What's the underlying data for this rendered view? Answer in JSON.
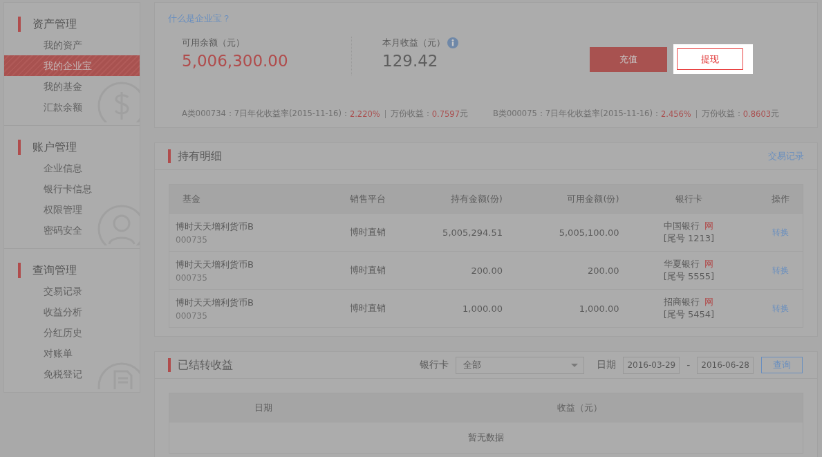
{
  "sidebar": {
    "groups": [
      {
        "title": "资产管理",
        "kind": "assets",
        "items": [
          {
            "label": "我的资产",
            "selected": false
          },
          {
            "label": "我的企业宝",
            "selected": true
          },
          {
            "label": "我的基金",
            "selected": false
          },
          {
            "label": "汇款余额",
            "selected": false
          }
        ]
      },
      {
        "title": "账户管理",
        "kind": "account",
        "items": [
          {
            "label": "企业信息",
            "selected": false
          },
          {
            "label": "银行卡信息",
            "selected": false
          },
          {
            "label": "权限管理",
            "selected": false
          },
          {
            "label": "密码安全",
            "selected": false
          }
        ]
      },
      {
        "title": "查询管理",
        "kind": "query",
        "items": [
          {
            "label": "交易记录",
            "selected": false
          },
          {
            "label": "收益分析",
            "selected": false
          },
          {
            "label": "分红历史",
            "selected": false
          },
          {
            "label": "对账单",
            "selected": false
          },
          {
            "label": "免税登记",
            "selected": false
          }
        ]
      }
    ]
  },
  "summary": {
    "help_link": "什么是企业宝？",
    "stats": [
      {
        "label": "可用余额（元）",
        "value": "5,006,300.00",
        "kind": "highlight"
      },
      {
        "label": "本月收益（元）",
        "value": "129.42",
        "kind": "info"
      }
    ],
    "buttons": [
      {
        "label": "充值",
        "kind": "primary"
      },
      {
        "label": "提现",
        "kind": "spotlight"
      }
    ],
    "yields": [
      {
        "fund": "A类000734：7日年化收益率(2015-11-16)：",
        "rate": "2.220%",
        "per_10k_label": "万份收益：",
        "per_10k": "0.7597",
        "unit": "元"
      },
      {
        "fund": "B类000075：7日年化收益率(2015-11-16)：",
        "rate": "2.456%",
        "per_10k_label": "万份收益：",
        "per_10k": "0.8603",
        "unit": "元"
      }
    ]
  },
  "holdings": {
    "title": "持有明细",
    "link": "交易记录",
    "columns": [
      "基金",
      "销售平台",
      "持有金额(份)",
      "可用金额(份)",
      "银行卡",
      "操作"
    ],
    "rows": [
      {
        "fund": "博时天天增利货币B",
        "code": "000735",
        "platform": "博时直销",
        "held": "5,005,294.51",
        "available": "5,005,100.00",
        "bank": "中国银行",
        "badge": "网",
        "tail": "[尾号 1213]",
        "action": "转换"
      },
      {
        "fund": "博时天天增利货币B",
        "code": "000735",
        "platform": "博时直销",
        "held": "200.00",
        "available": "200.00",
        "bank": "华夏银行",
        "badge": "网",
        "tail": "[尾号 5555]",
        "action": "转换"
      },
      {
        "fund": "博时天天增利货币B",
        "code": "000735",
        "platform": "博时直销",
        "held": "1,000.00",
        "available": "1,000.00",
        "bank": "招商银行",
        "badge": "网",
        "tail": "[尾号 5454]",
        "action": "转换"
      }
    ]
  },
  "settled": {
    "title": "已结转收益",
    "bank_label": "银行卡",
    "bank_value": "全部",
    "date_label": "日期",
    "date_from": "2016-03-29",
    "date_sep": "-",
    "date_to": "2016-06-28",
    "query_button": "查询",
    "columns": [
      "日期",
      "收益（元）"
    ],
    "empty": "暂无数据"
  }
}
